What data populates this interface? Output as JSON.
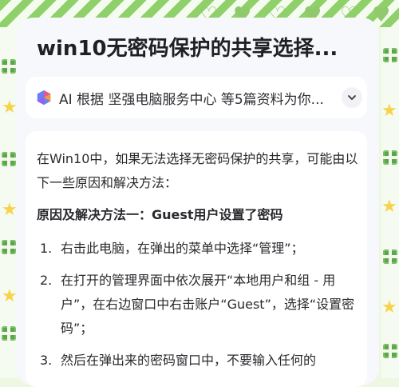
{
  "title": "win10无密码保护的共享选择...",
  "ai_summary": {
    "text": "AI 根据 坚强电脑服务中心 等5篇资料为你...",
    "icon": "ai-sparkle-icon",
    "expand_icon": "chevron-down-icon"
  },
  "answer": {
    "intro": "在Win10中，如果无法选择无密码保护的共享，可能由以下一些原因和解决方法：",
    "section_heading": "原因及解决方法一：Guest用户设置了密码",
    "steps": [
      {
        "num": "1.",
        "text": "右击此电脑，在弹出的菜单中选择“管理”；"
      },
      {
        "num": "2.",
        "text": "在打开的管理界面中依次展开“本地用户和组 - 用户”，在右边窗口中右击账户“Guest”，选择“设置密码”；"
      },
      {
        "num": "3.",
        "text": "然后在弹出来的密码窗口中，不要输入任何的"
      }
    ]
  },
  "colors": {
    "background": "#eef7e2",
    "panel": "#f7f8fc",
    "card": "#ffffff",
    "text": "#2a2a2e",
    "title": "#1f1f24",
    "decor_green": "#5aa64a",
    "decor_star": "#f6d34a"
  }
}
